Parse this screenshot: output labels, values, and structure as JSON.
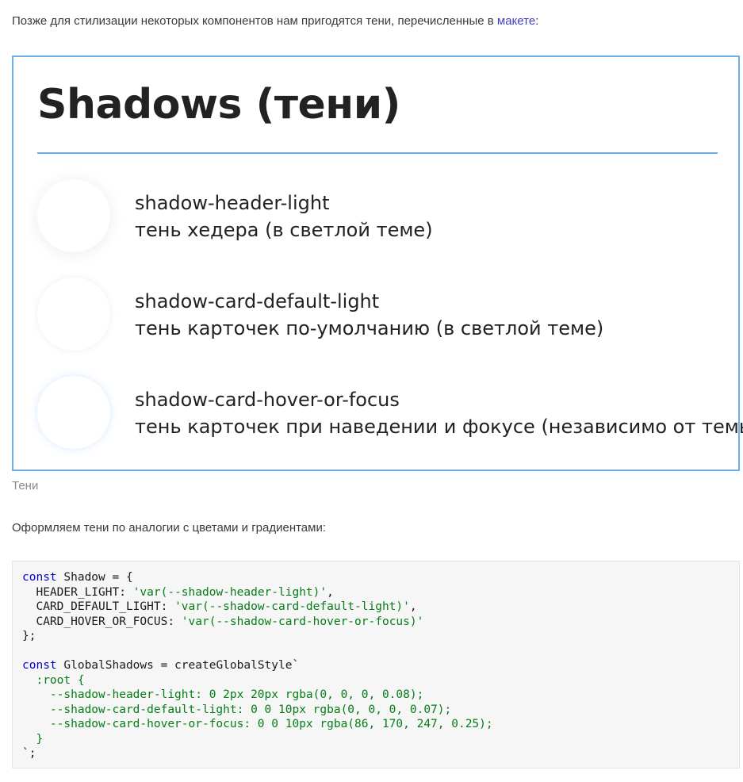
{
  "intro": {
    "text": "Позже для стилизации некоторых компонентов нам пригодятся тени, перечисленные в",
    "link": "макете",
    "suffix": ":"
  },
  "figure": {
    "title": "Shadows (тени)",
    "items": [
      {
        "name": "shadow-header-light",
        "desc": "тень хедера (в светлой теме)"
      },
      {
        "name": "shadow-card-default-light",
        "desc": "тень карточек по-умолчанию (в светлой  теме)"
      },
      {
        "name": "shadow-card-hover-or-focus",
        "desc": "тень карточек при наведении и фокусе (независимо от темы)"
      }
    ]
  },
  "caption": "Тени",
  "paragraph": "Оформляем тени по аналогии с цветами и градиентами:",
  "code": {
    "l1_kw": "const",
    "l1_rest": " Shadow = {",
    "l2_key": "  HEADER_LIGHT: ",
    "l2_val": "'var(--shadow-header-light)'",
    "l2_end": ",",
    "l3_key": "  CARD_DEFAULT_LIGHT: ",
    "l3_val": "'var(--shadow-card-default-light)'",
    "l3_end": ",",
    "l4_key": "  CARD_HOVER_OR_FOCUS: ",
    "l4_val": "'var(--shadow-card-hover-or-focus)'",
    "l5": "};",
    "l7_kw": "const",
    "l7_rest": " GlobalShadows = createGlobalStyle`",
    "l8": "  :root {",
    "l9": "    --shadow-header-light: 0 2px 20px rgba(0, 0, 0, 0.08);",
    "l10": "    --shadow-card-default-light: 0 0 10px rgba(0, 0, 0, 0.07);",
    "l11": "    --shadow-card-hover-or-focus: 0 0 10px rgba(86, 170, 247, 0.25);",
    "l12": "  }",
    "l13": "`;"
  },
  "colors": {
    "accent_border": "#6aaeea",
    "link": "#3d41c8",
    "code_keyword": "#0000c4",
    "code_string": "#067d17"
  }
}
